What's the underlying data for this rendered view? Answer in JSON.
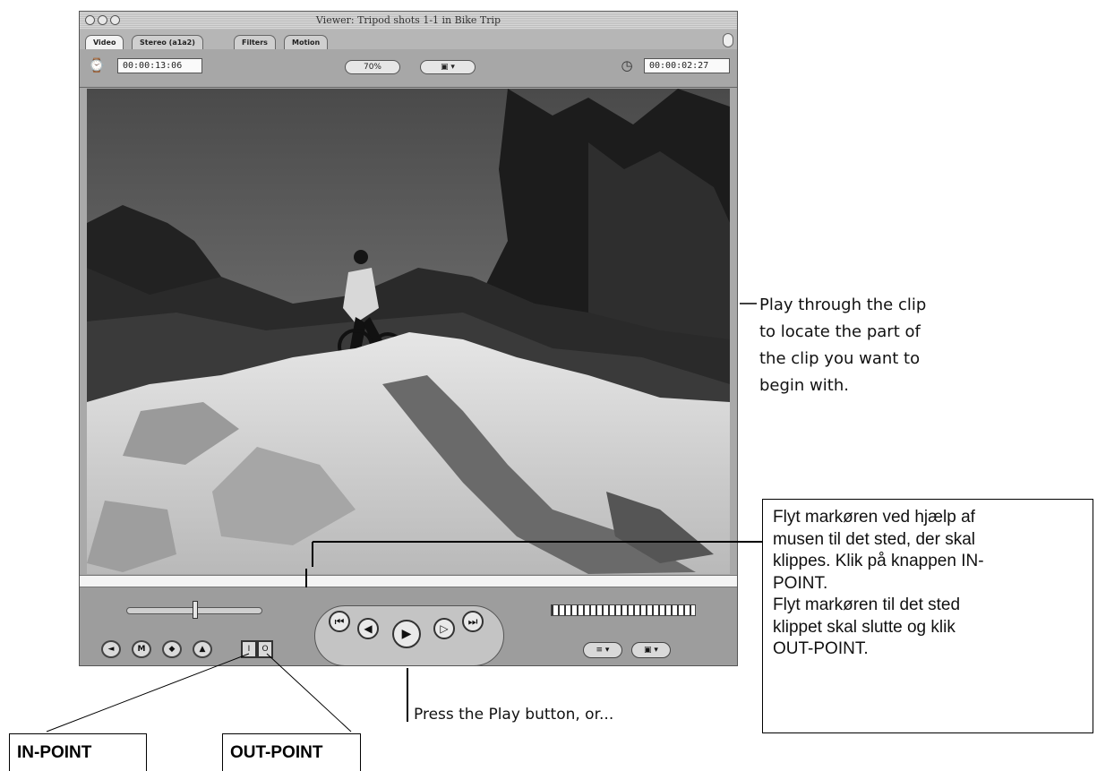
{
  "window": {
    "title": "Viewer: Tripod shots 1-1 in Bike Trip",
    "tabs": [
      {
        "label": "Video"
      },
      {
        "label": "Stereo (a1a2)"
      },
      {
        "label": "Filters"
      },
      {
        "label": "Motion"
      }
    ],
    "duration_timecode": "00:00:13:06",
    "zoom_label": "70%",
    "view_label": "▣ ▾",
    "current_timecode": "00:00:02:27"
  },
  "transport": {
    "buttons": [
      "⏮",
      "◀",
      "▶",
      "▷",
      "⏭"
    ],
    "edit_buttons": [
      "◄",
      "M",
      "◆",
      "▲"
    ],
    "in_point_label": "I",
    "out_point_label": "O",
    "popups": [
      "≡ ▾",
      "▣ ▾"
    ]
  },
  "annotations": {
    "play_through": [
      "Play through the clip",
      "to locate the part of",
      "the clip you want to",
      "begin with."
    ],
    "press_play": "Press the Play button, or...",
    "instructions": [
      "Flyt markøren ved hjælp af",
      "musen til det sted, der skal",
      "klippes. Klik på knappen IN-",
      "POINT.",
      "Flyt markøren til det sted",
      "klippet skal slutte og klik",
      "OUT-POINT."
    ],
    "in_point": "IN-POINT",
    "out_point": "OUT-POINT"
  }
}
